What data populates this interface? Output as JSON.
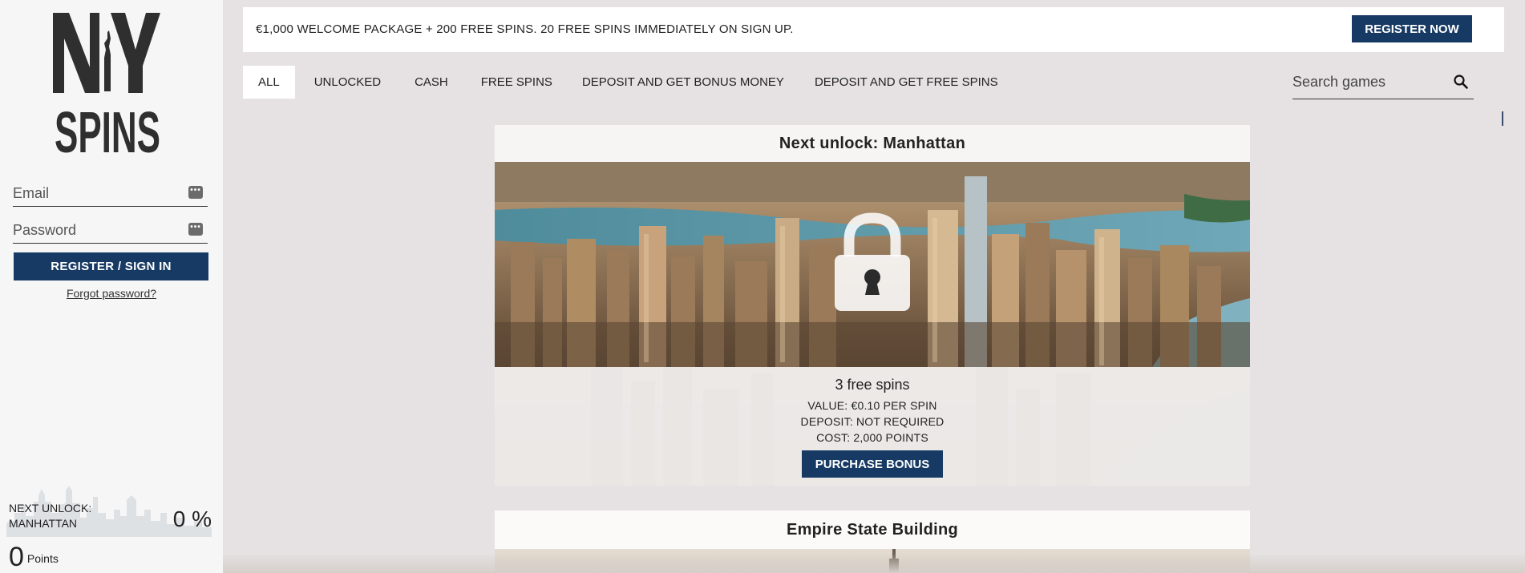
{
  "sidebar": {
    "logo_text": "NY SPINS",
    "email_placeholder": "Email",
    "password_placeholder": "Password",
    "key_icon": "•••",
    "register_label": "REGISTER / SIGN IN",
    "forgot_label": "Forgot password?",
    "unlock_label_line1": "NEXT UNLOCK:",
    "unlock_label_line2": "MANHATTAN",
    "unlock_percent": "0 %",
    "points_value": "0",
    "points_label": "Points"
  },
  "promo": {
    "text": "€1,000 WELCOME PACKAGE + 200 FREE SPINS. 20 FREE SPINS IMMEDIATELY ON SIGN UP.",
    "register_now_label": "REGISTER NOW"
  },
  "tabs": [
    {
      "label": "ALL",
      "active": true
    },
    {
      "label": "UNLOCKED",
      "active": false
    },
    {
      "label": "CASH",
      "active": false
    },
    {
      "label": "FREE SPINS",
      "active": false
    },
    {
      "label": "DEPOSIT AND GET BONUS MONEY",
      "active": false
    },
    {
      "label": "DEPOSIT AND GET FREE SPINS",
      "active": false
    }
  ],
  "search": {
    "placeholder": "Search games",
    "icon": "search-icon"
  },
  "cards": [
    {
      "title": "Next unlock: Manhattan",
      "locked": true,
      "spins": "3 free spins",
      "value_line": "VALUE: €0.10 PER SPIN",
      "deposit_line": "DEPOSIT: NOT REQUIRED",
      "cost_line": "COST: 2,000 POINTS",
      "button_label": "PURCHASE BONUS"
    },
    {
      "title": "Empire State Building"
    }
  ],
  "colors": {
    "navy": "#173a64",
    "background": "#e6e2e3",
    "sidebar": "#f6f6f7"
  }
}
